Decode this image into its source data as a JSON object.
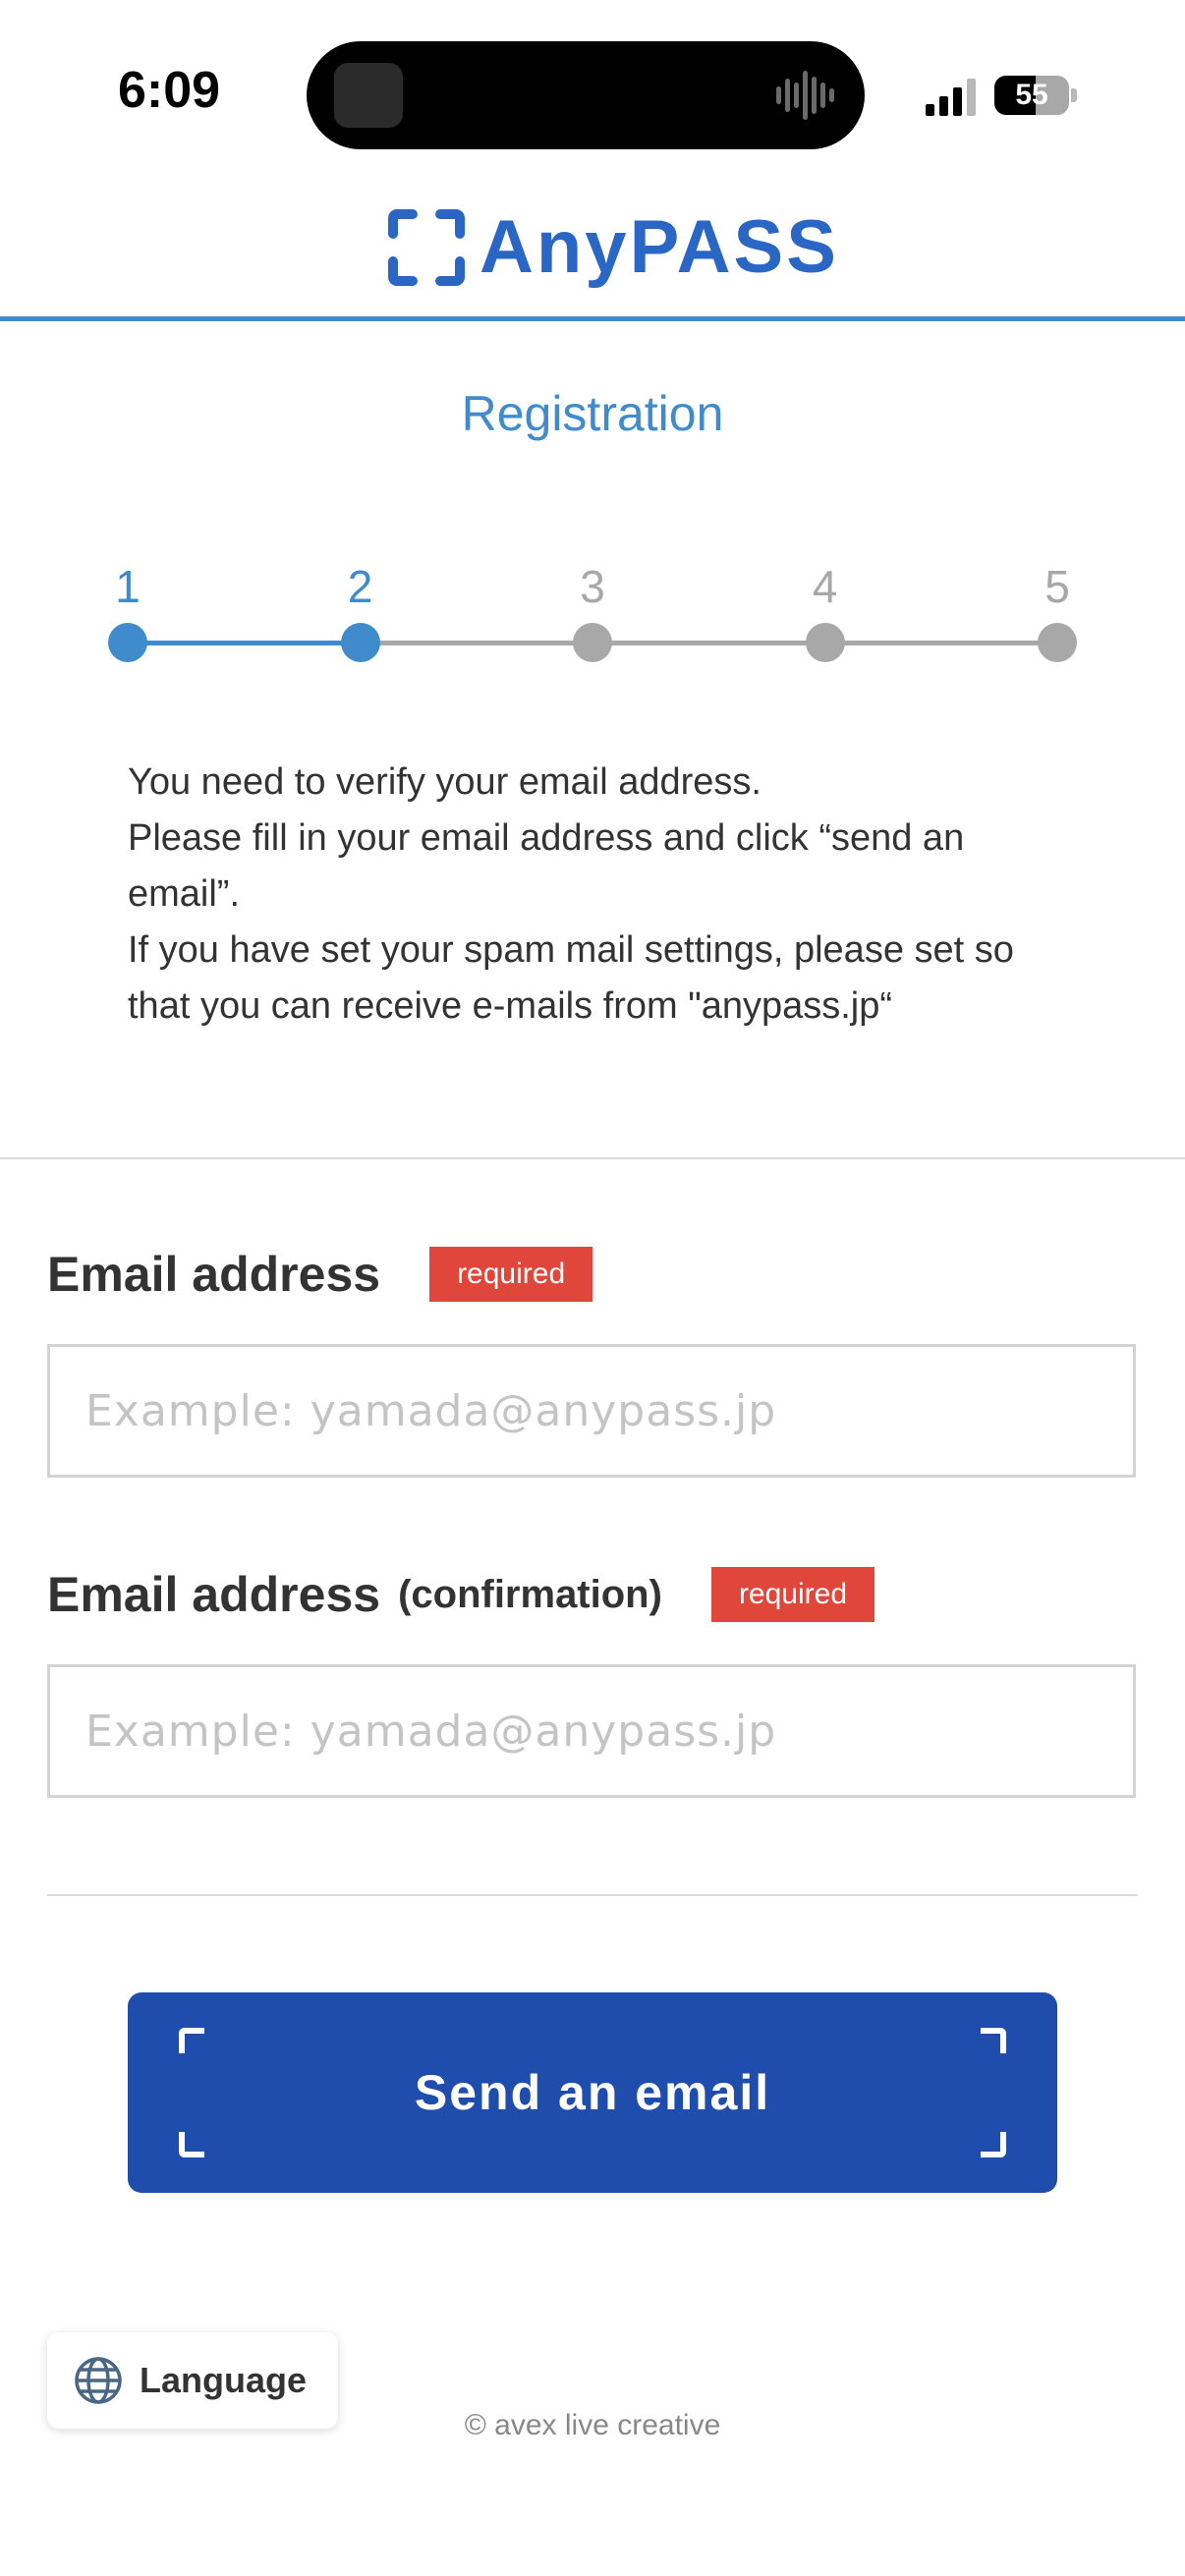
{
  "status_bar": {
    "time": "6:09",
    "battery": "55",
    "battery_level": 0.55
  },
  "header": {
    "logo_text": "AnyPASS"
  },
  "page": {
    "title": "Registration"
  },
  "stepper": {
    "steps": [
      "1",
      "2",
      "3",
      "4",
      "5"
    ],
    "current_step": 2,
    "active_color": "#3f8bcb",
    "inactive_color": "#a8a8a8"
  },
  "intro": {
    "line1": "You need to verify your email address.",
    "line2": "Please fill in your email address and click “send an email”.",
    "line3": "If you have set your spam mail settings, please set so that you can receive e-mails from \"anypass.jp“"
  },
  "form": {
    "email_label": "Email address",
    "confirm_label": "Email address",
    "confirm_sub": "(confirmation)",
    "required_badge": "required",
    "email_placeholder": "Example: yamada@anypass.jp",
    "confirm_placeholder": "Example: yamada@anypass.jp",
    "email_value": "",
    "confirm_value": ""
  },
  "actions": {
    "send_label": "Send an email"
  },
  "language": {
    "label": "Language"
  },
  "footer": {
    "copyright": "© avex live creative"
  },
  "colors": {
    "brand": "#2a66c4",
    "accent": "#3f8bcb",
    "button": "#1f4dad",
    "required": "#e0463a"
  }
}
